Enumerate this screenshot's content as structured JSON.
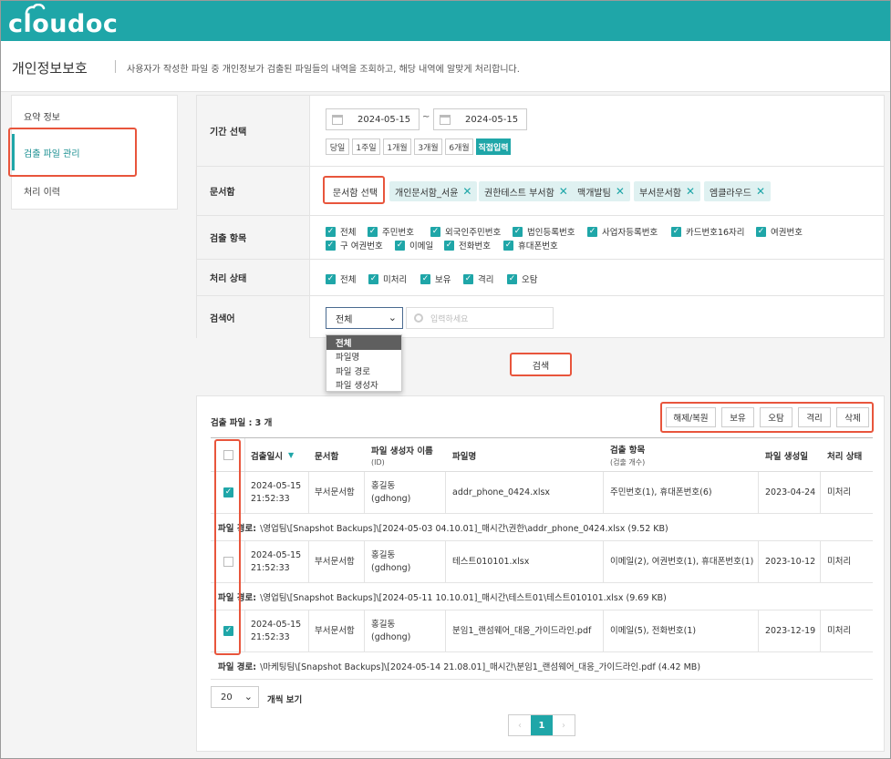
{
  "app": {
    "logo": "cloudoc"
  },
  "header": {
    "title": "개인정보보호",
    "description": "사용자가 작성한 파일 중 개인정보가 검출된 파일들의 내역을 조회하고, 해당 내역에 알맞게 처리합니다."
  },
  "sidebar": {
    "items": [
      {
        "label": "요약 정보",
        "active": false
      },
      {
        "label": "검출 파일 관리",
        "active": true
      },
      {
        "label": "처리 이력",
        "active": false
      }
    ]
  },
  "filters": {
    "period": {
      "label": "기간 선택",
      "start": "2024-05-15",
      "separator": "~",
      "end": "2024-05-15",
      "quick": [
        "당일",
        "1주일",
        "1개월",
        "3개월",
        "6개월",
        "직접입력"
      ],
      "quick_selected": "직접입력"
    },
    "box": {
      "label": "문서함",
      "select_button": "문서함 선택",
      "tags": [
        "개인문서함_서윤",
        "권한테스트 부서함",
        "맥개발팀",
        "부서문서함",
        "엠클라우드"
      ]
    },
    "items": {
      "label": "검출 항목",
      "options": [
        "전체",
        "주민번호",
        "외국인주민번호",
        "법인등록번호",
        "사업자등록번호",
        "카드번호16자리",
        "여권번호",
        "구 여권번호",
        "이메일",
        "전화번호",
        "휴대폰번호"
      ]
    },
    "status": {
      "label": "처리 상태",
      "options": [
        "전체",
        "미처리",
        "보유",
        "격리",
        "오탐"
      ]
    },
    "keyword": {
      "label": "검색어",
      "select_value": "전체",
      "placeholder": "입력하세요",
      "dropdown_options": [
        "전체",
        "파일명",
        "파일 경로",
        "파일 생성자"
      ]
    },
    "search_button": "검색"
  },
  "results": {
    "count_label": "검출 파일 : 3 개",
    "actions": [
      "해제/복원",
      "보유",
      "오탐",
      "격리",
      "삭제"
    ],
    "columns": {
      "date": "검출일시",
      "box": "문서함",
      "creator": "파일 생성자 이름",
      "creator_sub": "(ID)",
      "filename": "파일명",
      "items": "검출 항목",
      "items_sub": "(검출 개수)",
      "created": "파일 생성일",
      "status": "처리 상태"
    },
    "rows": [
      {
        "checked": true,
        "date": "2024-05-15",
        "time": "21:52:33",
        "box": "부서문서함",
        "creator": "홍길동",
        "creator_id": "(gdhong)",
        "filename": "addr_phone_0424.xlsx",
        "items": "주민번호(1), 휴대폰번호(6)",
        "created": "2023-04-24",
        "status": "미처리",
        "path_label": "파일 경로:",
        "path": "\\영업팀\\[Snapshot Backups]\\[2024-05-03 04.10.01]_매시간\\권한\\addr_phone_0424.xlsx (9.52 KB)"
      },
      {
        "checked": false,
        "date": "2024-05-15",
        "time": "21:52:33",
        "box": "부서문서함",
        "creator": "홍길동",
        "creator_id": "(gdhong)",
        "filename": "테스트010101.xlsx",
        "items": "이메일(2), 여권번호(1), 휴대폰번호(1)",
        "created": "2023-10-12",
        "status": "미처리",
        "path_label": "파일 경로:",
        "path": "\\영업팀\\[Snapshot Backups]\\[2024-05-11 10.10.01]_매시간\\테스트01\\테스트010101.xlsx (9.69 KB)"
      },
      {
        "checked": true,
        "date": "2024-05-15",
        "time": "21:52:33",
        "box": "부서문서함",
        "creator": "홍길동",
        "creator_id": "(gdhong)",
        "filename": "분임1_랜섬웨어_대응_가이드라인.pdf",
        "items": "이메일(5), 전화번호(1)",
        "created": "2023-12-19",
        "status": "미처리",
        "path_label": "파일 경로:",
        "path": "\\마케팅팀\\[Snapshot Backups]\\[2024-05-14 21.08.01]_매시간\\분임1_랜섬웨어_대응_가이드라인.pdf (4.42 MB)"
      }
    ],
    "per_page": "20",
    "per_page_label": "개씩 보기",
    "pagination": {
      "prev": "‹",
      "current": "1",
      "next": "›"
    }
  },
  "colors": {
    "brand": "#1fa6a8",
    "highlight": "#e8553c"
  }
}
